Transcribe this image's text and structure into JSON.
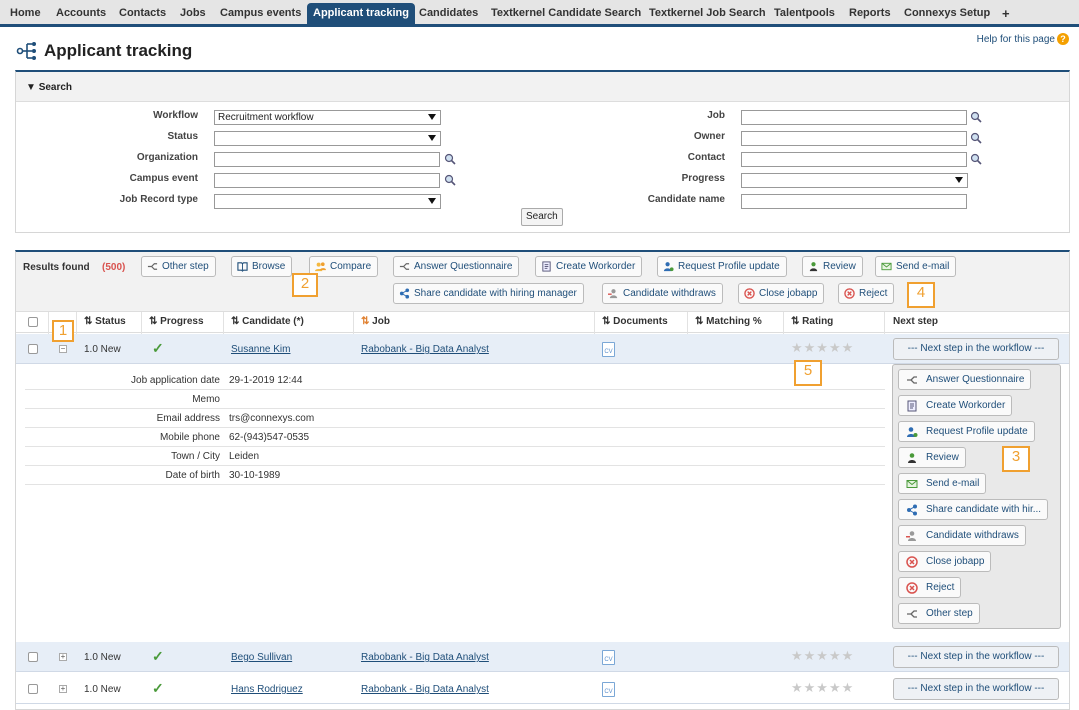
{
  "nav": {
    "tabs": [
      "Home",
      "Accounts",
      "Contacts",
      "Jobs",
      "Campus events",
      "Applicant tracking",
      "Candidates",
      "Textkernel Candidate Search",
      "Textkernel Job Search",
      "Talentpools",
      "Reports",
      "Connexys Setup"
    ],
    "active_tab": "Applicant tracking",
    "add_tab": "+"
  },
  "header": {
    "title": "Applicant tracking",
    "help_link": "Help for this page"
  },
  "search": {
    "section_title": "Search",
    "fields": {
      "workflow": {
        "label": "Workflow",
        "value": "Recruitment workflow"
      },
      "status": {
        "label": "Status",
        "value": ""
      },
      "organization": {
        "label": "Organization",
        "value": ""
      },
      "campus_event": {
        "label": "Campus event",
        "value": ""
      },
      "job_record_type": {
        "label": "Job Record type",
        "value": ""
      },
      "job": {
        "label": "Job",
        "value": ""
      },
      "owner": {
        "label": "Owner",
        "value": ""
      },
      "contact": {
        "label": "Contact",
        "value": ""
      },
      "progress": {
        "label": "Progress",
        "value": ""
      },
      "candidate_name": {
        "label": "Candidate name",
        "value": ""
      }
    },
    "button": "Search"
  },
  "results": {
    "label": "Results found",
    "count": "(500)",
    "actions": {
      "other_step": "Other step",
      "browse": "Browse",
      "compare": "Compare",
      "answer_questionnaire": "Answer Questionnaire",
      "create_workorder": "Create Workorder",
      "request_profile_update": "Request Profile update",
      "review": "Review",
      "send_email": "Send e-mail",
      "share_candidate": "Share candidate with hiring manager",
      "candidate_withdraws": "Candidate withdraws",
      "close_jobapp": "Close jobapp",
      "reject": "Reject"
    },
    "columns": [
      "Status",
      "Progress",
      "Candidate (*)",
      "Job",
      "Documents",
      "Matching %",
      "Rating",
      "Next step"
    ],
    "rows": [
      {
        "status": "1.0 New",
        "progress": "✓",
        "candidate": "Susanne Kim",
        "job": "Rabobank - Big Data Analyst",
        "document": "CV",
        "rating": "★★★★★",
        "next_step": "--- Next step in the workflow ---",
        "expand": "−"
      },
      {
        "status": "1.0 New",
        "progress": "✓",
        "candidate": "Bego Sullivan",
        "job": "Rabobank - Big Data Analyst",
        "document": "CV",
        "rating": "★★★★★",
        "next_step": "--- Next step in the workflow ---",
        "expand": "+"
      },
      {
        "status": "1.0 New",
        "progress": "✓",
        "candidate": "Hans Rodriguez",
        "job": "Rabobank - Big Data Analyst",
        "document": "CV",
        "rating": "★★★★★",
        "next_step": "--- Next step in the workflow ---",
        "expand": "+"
      }
    ],
    "details": [
      {
        "label": "Job application date",
        "value": "29-1-2019 12:44"
      },
      {
        "label": "Memo",
        "value": ""
      },
      {
        "label": "Email address",
        "value": "trs@connexys.com"
      },
      {
        "label": "Mobile phone",
        "value": "62-(943)547-0535"
      },
      {
        "label": "Town / City",
        "value": "Leiden"
      },
      {
        "label": "Date of birth",
        "value": "30-10-1989"
      }
    ],
    "menu": {
      "answer_questionnaire": "Answer Questionnaire",
      "create_workorder": "Create Workorder",
      "request_profile_update": "Request Profile update",
      "review": "Review",
      "send_email": "Send e-mail",
      "share_candidate": "Share candidate with hir...",
      "candidate_withdraws": "Candidate withdraws",
      "close_jobapp": "Close jobapp",
      "reject": "Reject",
      "other_step": "Other step"
    }
  },
  "markers": {
    "m1": "1",
    "m2": "2",
    "m3": "3",
    "m4": "4",
    "m5": "5"
  },
  "colors": {
    "nav_active": "#1f4e79",
    "link": "#1f4e79",
    "marker": "#f0a030",
    "count": "#d9534f",
    "check": "#4a9a3a"
  }
}
